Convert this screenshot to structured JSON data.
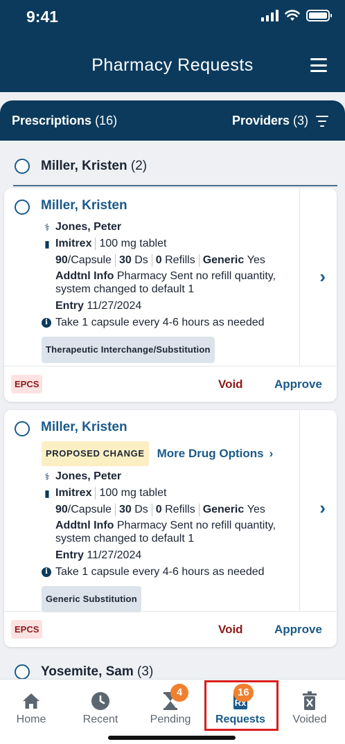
{
  "status_bar": {
    "time": "9:41"
  },
  "header": {
    "title": "Pharmacy Requests"
  },
  "segment": {
    "prescriptions_label": "Prescriptions",
    "prescriptions_count": "(16)",
    "providers_label": "Providers",
    "providers_count": "(3)"
  },
  "groups": [
    {
      "name": "Miller, Kristen",
      "count": "(2)"
    },
    {
      "name": "Yosemite, Sam",
      "count": "(3)"
    }
  ],
  "cards": [
    {
      "patient": "Miller, Kristen",
      "provider": "Jones, Peter",
      "drug": "Imitrex",
      "dose": "100 mg tablet",
      "qty": "90",
      "qty_unit": "/Capsule",
      "days": "30",
      "days_unit": "Ds",
      "refills": "0",
      "refills_unit": "Refills",
      "generic_label": "Generic",
      "generic_value": "Yes",
      "info_label": "Addtnl Info",
      "info_text": "Pharmacy Sent no refill quantity, system changed to default 1",
      "entry_label": "Entry",
      "entry_date": "11/27/2024",
      "sig": "Take 1 capsule every 4-6 hours as needed",
      "tag": "Therapeutic Interchange/Substitution",
      "epcs": "EPCS",
      "void": "Void",
      "approve": "Approve"
    },
    {
      "patient": "Miller, Kristen",
      "proposed": "PROPOSED CHANGE",
      "more_options": "More Drug Options",
      "provider": "Jones, Peter",
      "drug": "Imitrex",
      "dose": "100 mg tablet",
      "qty": "90",
      "qty_unit": "/Capsule",
      "days": "30",
      "days_unit": "Ds",
      "refills": "0",
      "refills_unit": "Refills",
      "generic_label": "Generic",
      "generic_value": "Yes",
      "info_label": "Addtnl Info",
      "info_text": "Pharmacy Sent no refill quantity, system changed to default 1",
      "entry_label": "Entry",
      "entry_date": "11/27/2024",
      "sig": "Take 1 capsule every 4-6 hours as needed",
      "tag": "Generic Substitution",
      "epcs": "EPCS",
      "void": "Void",
      "approve": "Approve"
    }
  ],
  "nav": {
    "home": "Home",
    "recent": "Recent",
    "pending": "Pending",
    "pending_badge": "4",
    "requests": "Requests",
    "requests_badge": "16",
    "voided": "Voided"
  },
  "colors": {
    "primary": "#0b3a5c",
    "link": "#1a5a8a",
    "void": "#8b1a1a",
    "badge": "#f07f2e",
    "highlight": "#d81c1c"
  }
}
